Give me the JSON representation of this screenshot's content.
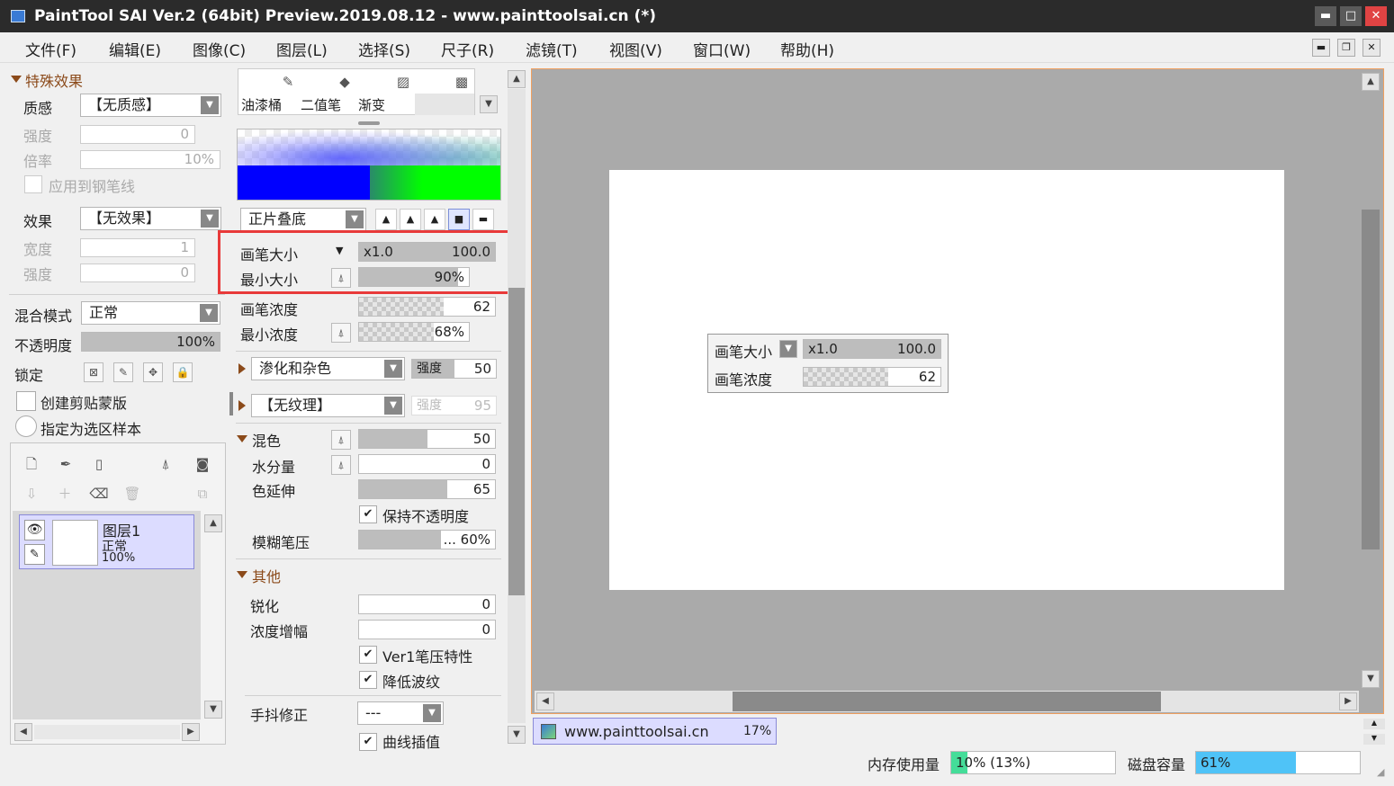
{
  "window": {
    "title": "PaintTool SAI Ver.2 (64bit) Preview.2019.08.12 - www.painttoolsai.cn (*)",
    "minimize": "▬",
    "maximize": "□",
    "close": "✕"
  },
  "menu": [
    "文件(F)",
    "编辑(E)",
    "图像(C)",
    "图层(L)",
    "选择(S)",
    "尺子(R)",
    "滤镜(T)",
    "视图(V)",
    "窗口(W)",
    "帮助(H)"
  ],
  "mdi_controls": {
    "minimize": "▬",
    "restore": "❐",
    "close": "✕"
  },
  "effects": {
    "header": "特殊效果",
    "texture_label": "质感",
    "texture_value": "【无质感】",
    "strength_label": "强度",
    "strength_value": "0",
    "scale_label": "倍率",
    "scale_value": "10%",
    "apply_pen": "应用到钢笔线",
    "effect_label": "效果",
    "effect_value": "【无效果】",
    "width_label": "宽度",
    "width_value": "1",
    "strength2_label": "强度",
    "strength2_value": "0"
  },
  "layer_props": {
    "blend_label": "混合模式",
    "blend_value": "正常",
    "opacity_label": "不透明度",
    "opacity_value": "100%",
    "lock_label": "锁定",
    "clip_label": "创建剪贴蒙版",
    "sample_label": "指定为选区样本"
  },
  "layers": [
    {
      "name": "图层1",
      "mode": "正常",
      "opacity": "100%"
    }
  ],
  "brush_tools": {
    "tools": [
      "油漆桶",
      "二值笔",
      "渐变"
    ]
  },
  "brush": {
    "blend_mode": "正片叠底",
    "size_label": "画笔大小",
    "size_mult": "x1.0",
    "size_value": "100.0",
    "min_size_label": "最小大小",
    "min_size_value": "90%",
    "min_size_level": 0.9,
    "density_label": "画笔浓度",
    "density_value": "62",
    "min_density_label": "最小浓度",
    "min_density_value": "68%",
    "min_density_level": 0.68,
    "noise_label": "渗化和杂色",
    "noise_strength_label": "强度",
    "noise_strength_value": "50",
    "texture_value": "【无纹理】",
    "texture_strength_label": "强度",
    "texture_strength_value": "95",
    "mix_section": "混色",
    "mix_value": "50",
    "water_label": "水分量",
    "water_value": "0",
    "stretch_label": "色延伸",
    "stretch_value": "65",
    "keep_opacity": "保持不透明度",
    "blur_label": "模糊笔压",
    "blur_value": "... 60%",
    "other_section": "其他",
    "sharpen_label": "锐化",
    "sharpen_value": "0",
    "boost_label": "浓度增幅",
    "boost_value": "0",
    "ver1_label": "Ver1笔压特性",
    "ripple_label": "降低波纹",
    "stabilizer_label": "手抖修正",
    "stabilizer_value": "---",
    "curve_label": "曲线插值"
  },
  "canvas_popup": {
    "size_label": "画笔大小",
    "size_mult": "x1.0",
    "size_value": "100.0",
    "density_label": "画笔浓度",
    "density_value": "62"
  },
  "document_tab": {
    "name": "www.painttoolsai.cn",
    "zoom": "17%"
  },
  "status": {
    "memory_label": "内存使用量",
    "memory_value": "10% (13%)",
    "memory_level": 0.1,
    "disk_label": "磁盘容量",
    "disk_value": "61%",
    "disk_level": 0.61
  },
  "colors": {
    "highlight": "#e83a3a",
    "blue": "#0000ff",
    "green": "#00ff00",
    "disk_fill": "#4fc3f7",
    "memory_fill": "#44dd99",
    "layer_selected": "#dcdcff"
  }
}
